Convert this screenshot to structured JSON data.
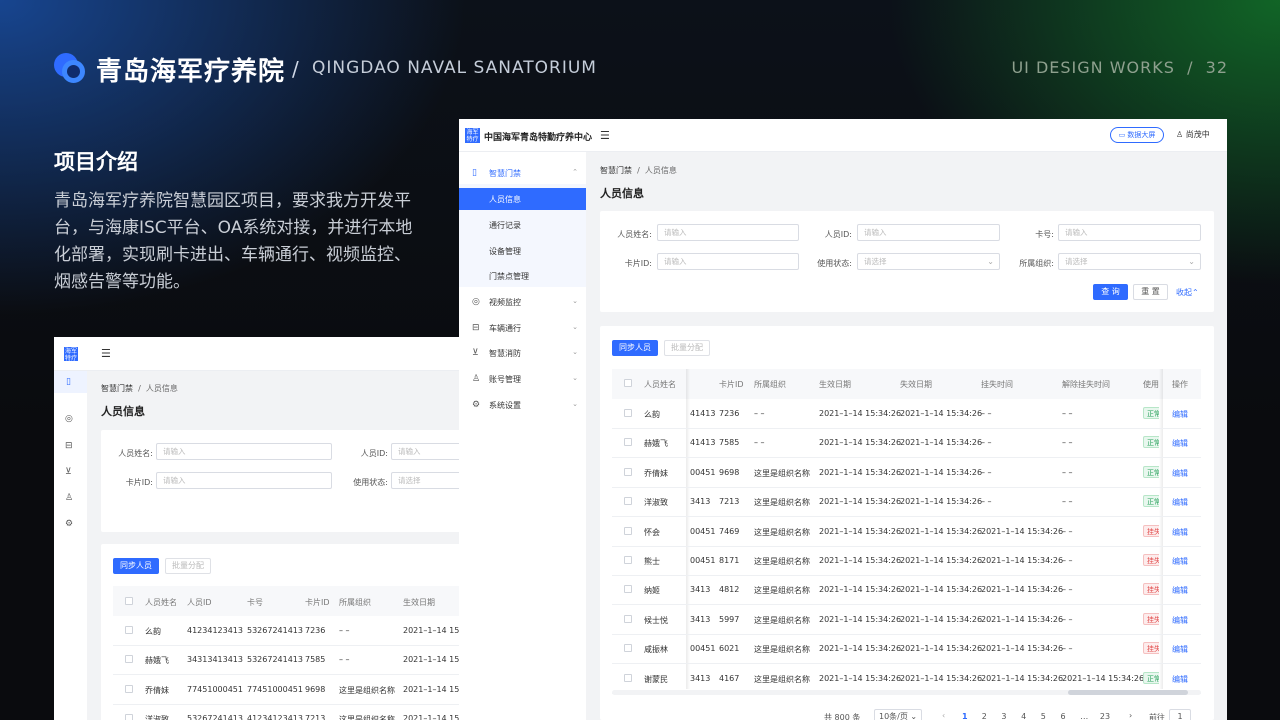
{
  "header": {
    "title_cn": "青岛海军疗养院",
    "separator": "/",
    "title_en": "QINGDAO NAVAL SANATORIUM",
    "works": "UI DESIGN WORKS",
    "works_sep": "/",
    "page_number": "32"
  },
  "intro": {
    "heading": "项目介绍",
    "paragraph": "青岛海军疗养院智慧园区项目，要求我方开发平台，与海康ISC平台、OA系统对接，并进行本地化部署，实现刷卡进出、车辆通行、视频监控、烟感告警等功能。"
  },
  "app": {
    "brand_mark": "海军特疗",
    "org_name": "中国海军青岛特勤疗养中心",
    "big_screen_button": "数据大屏",
    "user_name": "尚茂中",
    "sidebar": {
      "groups": [
        {
          "label": "智慧门禁",
          "icon": "door-icon",
          "expanded": true,
          "children": [
            "人员信息",
            "通行记录",
            "设备管理",
            "门禁点管理"
          ]
        },
        {
          "label": "视频监控",
          "icon": "camera-icon"
        },
        {
          "label": "车辆通行",
          "icon": "car-icon"
        },
        {
          "label": "智慧消防",
          "icon": "fire-icon"
        },
        {
          "label": "账号管理",
          "icon": "user-icon"
        },
        {
          "label": "系统设置",
          "icon": "gear-icon"
        }
      ],
      "active_child": "人员信息"
    },
    "breadcrumb": {
      "root": "智慧门禁",
      "sep": "/",
      "current": "人员信息"
    },
    "page_title": "人员信息",
    "filters": {
      "name_label": "人员姓名:",
      "name_placeholder": "请输入",
      "id_label": "人员ID:",
      "id_placeholder": "请输入",
      "card_label": "卡号:",
      "card_placeholder": "请输入",
      "cardid_label": "卡片ID:",
      "cardid_placeholder": "请输入",
      "status_label": "使用状态:",
      "status_placeholder": "请选择",
      "org_label": "所属组织:",
      "org_placeholder": "请选择",
      "query_button": "查 询",
      "reset_button": "重 置",
      "collapse_link": "收起"
    },
    "actions": {
      "sync_button": "同步人员",
      "batch_button": "批量分配"
    },
    "table": {
      "columns_front": [
        "人员姓名",
        "卡片ID",
        "所属组织",
        "生效日期",
        "失效日期",
        "挂失时间",
        "解除挂失时间",
        "使用",
        "操作"
      ],
      "columns_back": [
        "人员姓名",
        "人员ID",
        "卡号",
        "卡片ID",
        "所属组织",
        "生效日期"
      ],
      "rows": [
        {
          "name": "么韵",
          "pid_tail": "41413",
          "pid": "41234123413",
          "card": "53267241413",
          "card_id": "7236",
          "org": "– –",
          "start": "2021–1–14 15:34:26",
          "end": "2021–1–14 15:34:26",
          "loss": "– –",
          "unloss": "– –",
          "status": "正常",
          "status_type": "ok",
          "op": "编辑"
        },
        {
          "name": "赫娥飞",
          "pid_tail": "41413",
          "pid": "34313413413",
          "card": "53267241413",
          "card_id": "7585",
          "org": "– –",
          "start": "2021–1–14 15:34:26",
          "end": "2021–1–14 15:34:26",
          "loss": "– –",
          "unloss": "– –",
          "status": "正常",
          "status_type": "ok",
          "op": "编辑"
        },
        {
          "name": "乔倩妹",
          "pid_tail": "00451",
          "pid": "77451000451",
          "card": "77451000451",
          "card_id": "9698",
          "org": "这里是组织名称",
          "start": "2021–1–14 15:34:26",
          "end": "2021–1–14 15:34:26",
          "loss": "– –",
          "unloss": "– –",
          "status": "正常",
          "status_type": "ok",
          "op": "编辑"
        },
        {
          "name": "洋淑致",
          "pid_tail": "3413",
          "pid": "53267241413",
          "card": "41234123413",
          "card_id": "7213",
          "org": "这里是组织名称",
          "start": "2021–1–14 15:34:26",
          "end": "2021–1–14 15:34:26",
          "loss": "– –",
          "unloss": "– –",
          "status": "正常",
          "status_type": "ok",
          "op": "编辑"
        },
        {
          "name": "怀会",
          "pid_tail": "00451",
          "card_id": "7469",
          "org": "这里是组织名称",
          "start": "2021–1–14 15:34:26",
          "end": "2021–1–14 15:34:26",
          "loss": "2021–1–14 15:34:26",
          "unloss": "– –",
          "status": "挂失",
          "status_type": "lost",
          "op": "编辑"
        },
        {
          "name": "熊士",
          "pid_tail": "00451",
          "card_id": "8171",
          "org": "这里是组织名称",
          "start": "2021–1–14 15:34:26",
          "end": "2021–1–14 15:34:26",
          "loss": "2021–1–14 15:34:26",
          "unloss": "– –",
          "status": "挂失",
          "status_type": "lost",
          "op": "编辑"
        },
        {
          "name": "纳姬",
          "pid_tail": "3413",
          "card_id": "4812",
          "org": "这里是组织名称",
          "start": "2021–1–14 15:34:26",
          "end": "2021–1–14 15:34:26",
          "loss": "2021–1–14 15:34:26",
          "unloss": "– –",
          "status": "挂失",
          "status_type": "lost",
          "op": "编辑"
        },
        {
          "name": "候士悦",
          "pid_tail": "3413",
          "card_id": "5997",
          "org": "这里是组织名称",
          "start": "2021–1–14 15:34:26",
          "end": "2021–1–14 15:34:26",
          "loss": "2021–1–14 15:34:26",
          "unloss": "– –",
          "status": "挂失",
          "status_type": "lost",
          "op": "编辑"
        },
        {
          "name": "咸振林",
          "pid_tail": "00451",
          "card_id": "6021",
          "org": "这里是组织名称",
          "start": "2021–1–14 15:34:26",
          "end": "2021–1–14 15:34:26",
          "loss": "2021–1–14 15:34:26",
          "unloss": "– –",
          "status": "挂失",
          "status_type": "lost",
          "op": "编辑"
        },
        {
          "name": "谢蒙民",
          "pid_tail": "3413",
          "card_id": "4167",
          "org": "这里是组织名称",
          "start": "2021–1–14 15:34:26",
          "end": "2021–1–14 15:34:26",
          "loss": "2021–1–14 15:34:26",
          "unloss": "2021–1–14 15:34:26",
          "status": "正常",
          "status_type": "ok",
          "op": "编辑"
        }
      ]
    },
    "pagination": {
      "total": "共 800 条",
      "page_size": "10条/页",
      "prev": "‹",
      "pages": [
        "1",
        "2",
        "3",
        "4",
        "5",
        "6",
        "…",
        "23"
      ],
      "current": "1",
      "next": "›",
      "goto_label": "前往",
      "goto_value": "1"
    }
  },
  "colors": {
    "accent": "#2f6bff",
    "ok": "#27a05a",
    "lost": "#e14a4a"
  }
}
